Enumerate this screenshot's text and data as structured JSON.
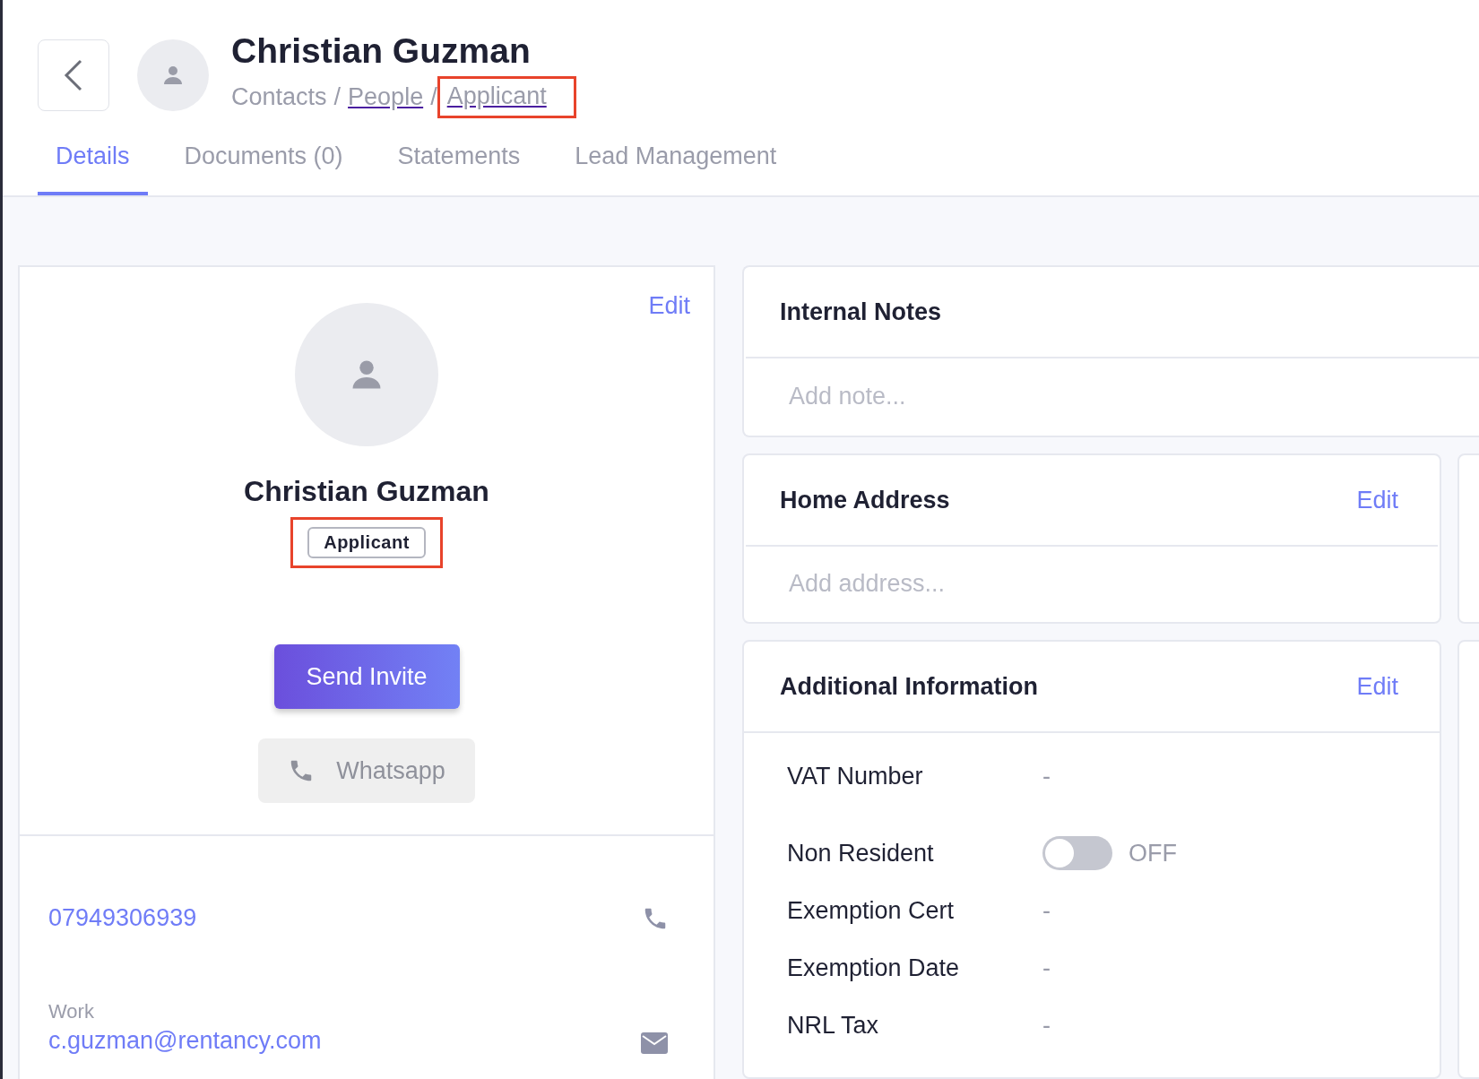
{
  "header": {
    "title": "Christian Guzman",
    "breadcrumb": [
      {
        "kind": "text",
        "label": "Contacts",
        "highlighted": false
      },
      {
        "kind": "separator",
        "label": "/",
        "highlighted": false
      },
      {
        "kind": "link",
        "label": "People",
        "highlighted": false
      },
      {
        "kind": "separator",
        "label": "/",
        "highlighted": false
      },
      {
        "kind": "link",
        "label": "Applicant",
        "highlighted": true
      }
    ]
  },
  "tabs": [
    {
      "label": "Details",
      "selected": true
    },
    {
      "label": "Documents (0)",
      "selected": false
    },
    {
      "label": "Statements",
      "selected": false
    },
    {
      "label": "Lead Management",
      "selected": false
    }
  ],
  "profile": {
    "edit": "Edit",
    "name": "Christian Guzman",
    "tag": {
      "label": "Applicant",
      "highlighted": true
    },
    "send_invite": "Send Invite",
    "whatsapp": {
      "label": "Whatsapp",
      "disabled": true
    },
    "contacts": [
      {
        "kind": "phone",
        "value": "07949306939"
      },
      {
        "kind": "email",
        "label": "Work",
        "value": "c.guzman@rentancy.com"
      }
    ]
  },
  "internal_notes": {
    "title": "Internal Notes",
    "placeholder": "Add note..."
  },
  "home_address": {
    "title": "Home Address",
    "edit": "Edit",
    "placeholder": "Add address..."
  },
  "additional_information": {
    "title": "Additional Information",
    "edit": "Edit",
    "fields": [
      {
        "kind": "text",
        "label": "VAT Number",
        "value": "-"
      },
      {
        "kind": "toggle",
        "label": "Non Resident",
        "on": false,
        "value": "OFF"
      },
      {
        "kind": "text",
        "label": "Exemption Cert",
        "value": "-"
      },
      {
        "kind": "text",
        "label": "Exemption Date",
        "value": "-"
      },
      {
        "kind": "text",
        "label": "NRL Tax",
        "value": "-"
      }
    ]
  }
}
